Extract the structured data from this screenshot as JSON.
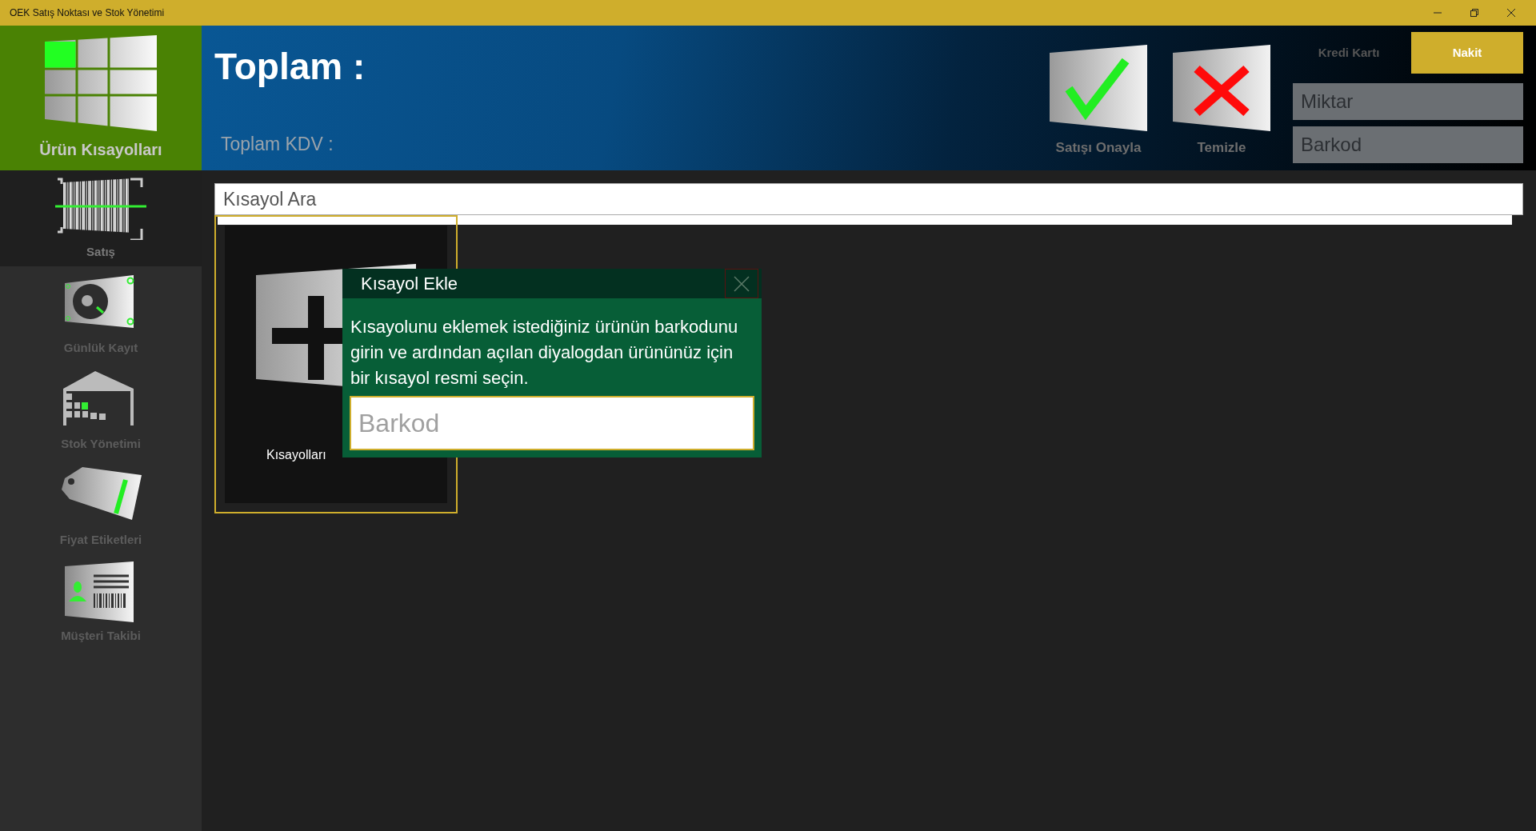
{
  "window": {
    "title": "OEK Satış Noktası ve Stok Yönetimi"
  },
  "header": {
    "tile_label": "Ürün Kısayolları",
    "total_label": "Toplam :",
    "vat_label": "Toplam KDV :",
    "actions": [
      {
        "kind": "confirm",
        "label": "Satışı Onayla"
      },
      {
        "kind": "clear",
        "label": "Temizle"
      }
    ],
    "payment_tabs": [
      {
        "label": "Kredi Kartı",
        "selected": false
      },
      {
        "label": "Nakit",
        "selected": true
      }
    ],
    "fields": [
      {
        "placeholder": "Miktar"
      },
      {
        "placeholder": "Barkod"
      }
    ]
  },
  "sidebar": {
    "items": [
      {
        "kind": "sale",
        "label": "Satış",
        "selected": true
      },
      {
        "kind": "daily",
        "label": "Günlük Kayıt",
        "selected": false
      },
      {
        "kind": "stock",
        "label": "Stok Yönetimi",
        "selected": false
      },
      {
        "kind": "labels",
        "label": "Fiyat Etiketleri",
        "selected": false
      },
      {
        "kind": "customers",
        "label": "Müşteri Takibi",
        "selected": false
      }
    ]
  },
  "search": {
    "placeholder": "Kısayol Ara"
  },
  "shortcuts": [
    {
      "kind": "edit",
      "label": "Kısayolları",
      "selected": true
    }
  ],
  "dialog": {
    "title": "Kısayol Ekle",
    "message": "Kısayolunu eklemek istediğiniz ürünün barkodunu girin ve ardından açılan diyalogdan ürününüz için bir kısayol resmi seçin.",
    "field": {
      "placeholder": "Barkod"
    }
  }
}
